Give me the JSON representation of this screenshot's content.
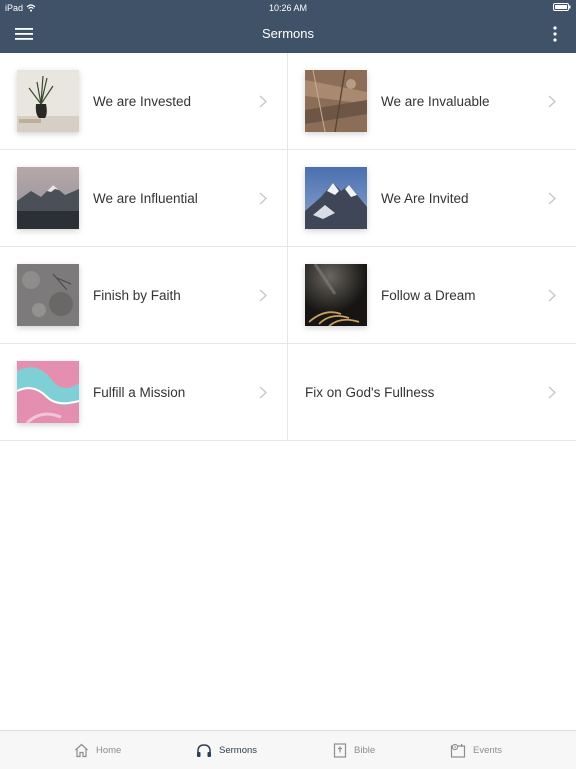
{
  "status_bar": {
    "device": "iPad",
    "time": "10:26 AM"
  },
  "header": {
    "title": "Sermons"
  },
  "sermons": [
    {
      "title": "We are Invested",
      "thumb": "vase-plant-icon"
    },
    {
      "title": "We are Invaluable",
      "thumb": "canyon-aerial-icon"
    },
    {
      "title": "We are Influential",
      "thumb": "mountain-dusk-icon"
    },
    {
      "title": "We Are Invited",
      "thumb": "snowy-peak-icon"
    },
    {
      "title": "Finish by Faith",
      "thumb": "stone-texture-icon"
    },
    {
      "title": "Follow a Dream",
      "thumb": "wheat-light-icon"
    },
    {
      "title": "Fulfill a Mission",
      "thumb": "marble-paint-icon"
    },
    {
      "title": "Fix on God's Fullness",
      "thumb": ""
    }
  ],
  "tabs": [
    {
      "label": "Home",
      "icon": "home-icon"
    },
    {
      "label": "Sermons",
      "icon": "headphones-icon",
      "active": true
    },
    {
      "label": "Bible",
      "icon": "bible-icon"
    },
    {
      "label": "Events",
      "icon": "calendar-icon"
    }
  ],
  "colors": {
    "header": "#3f5268",
    "active_tab": "#2f3e50",
    "inactive_tab": "#8e8e8e"
  }
}
